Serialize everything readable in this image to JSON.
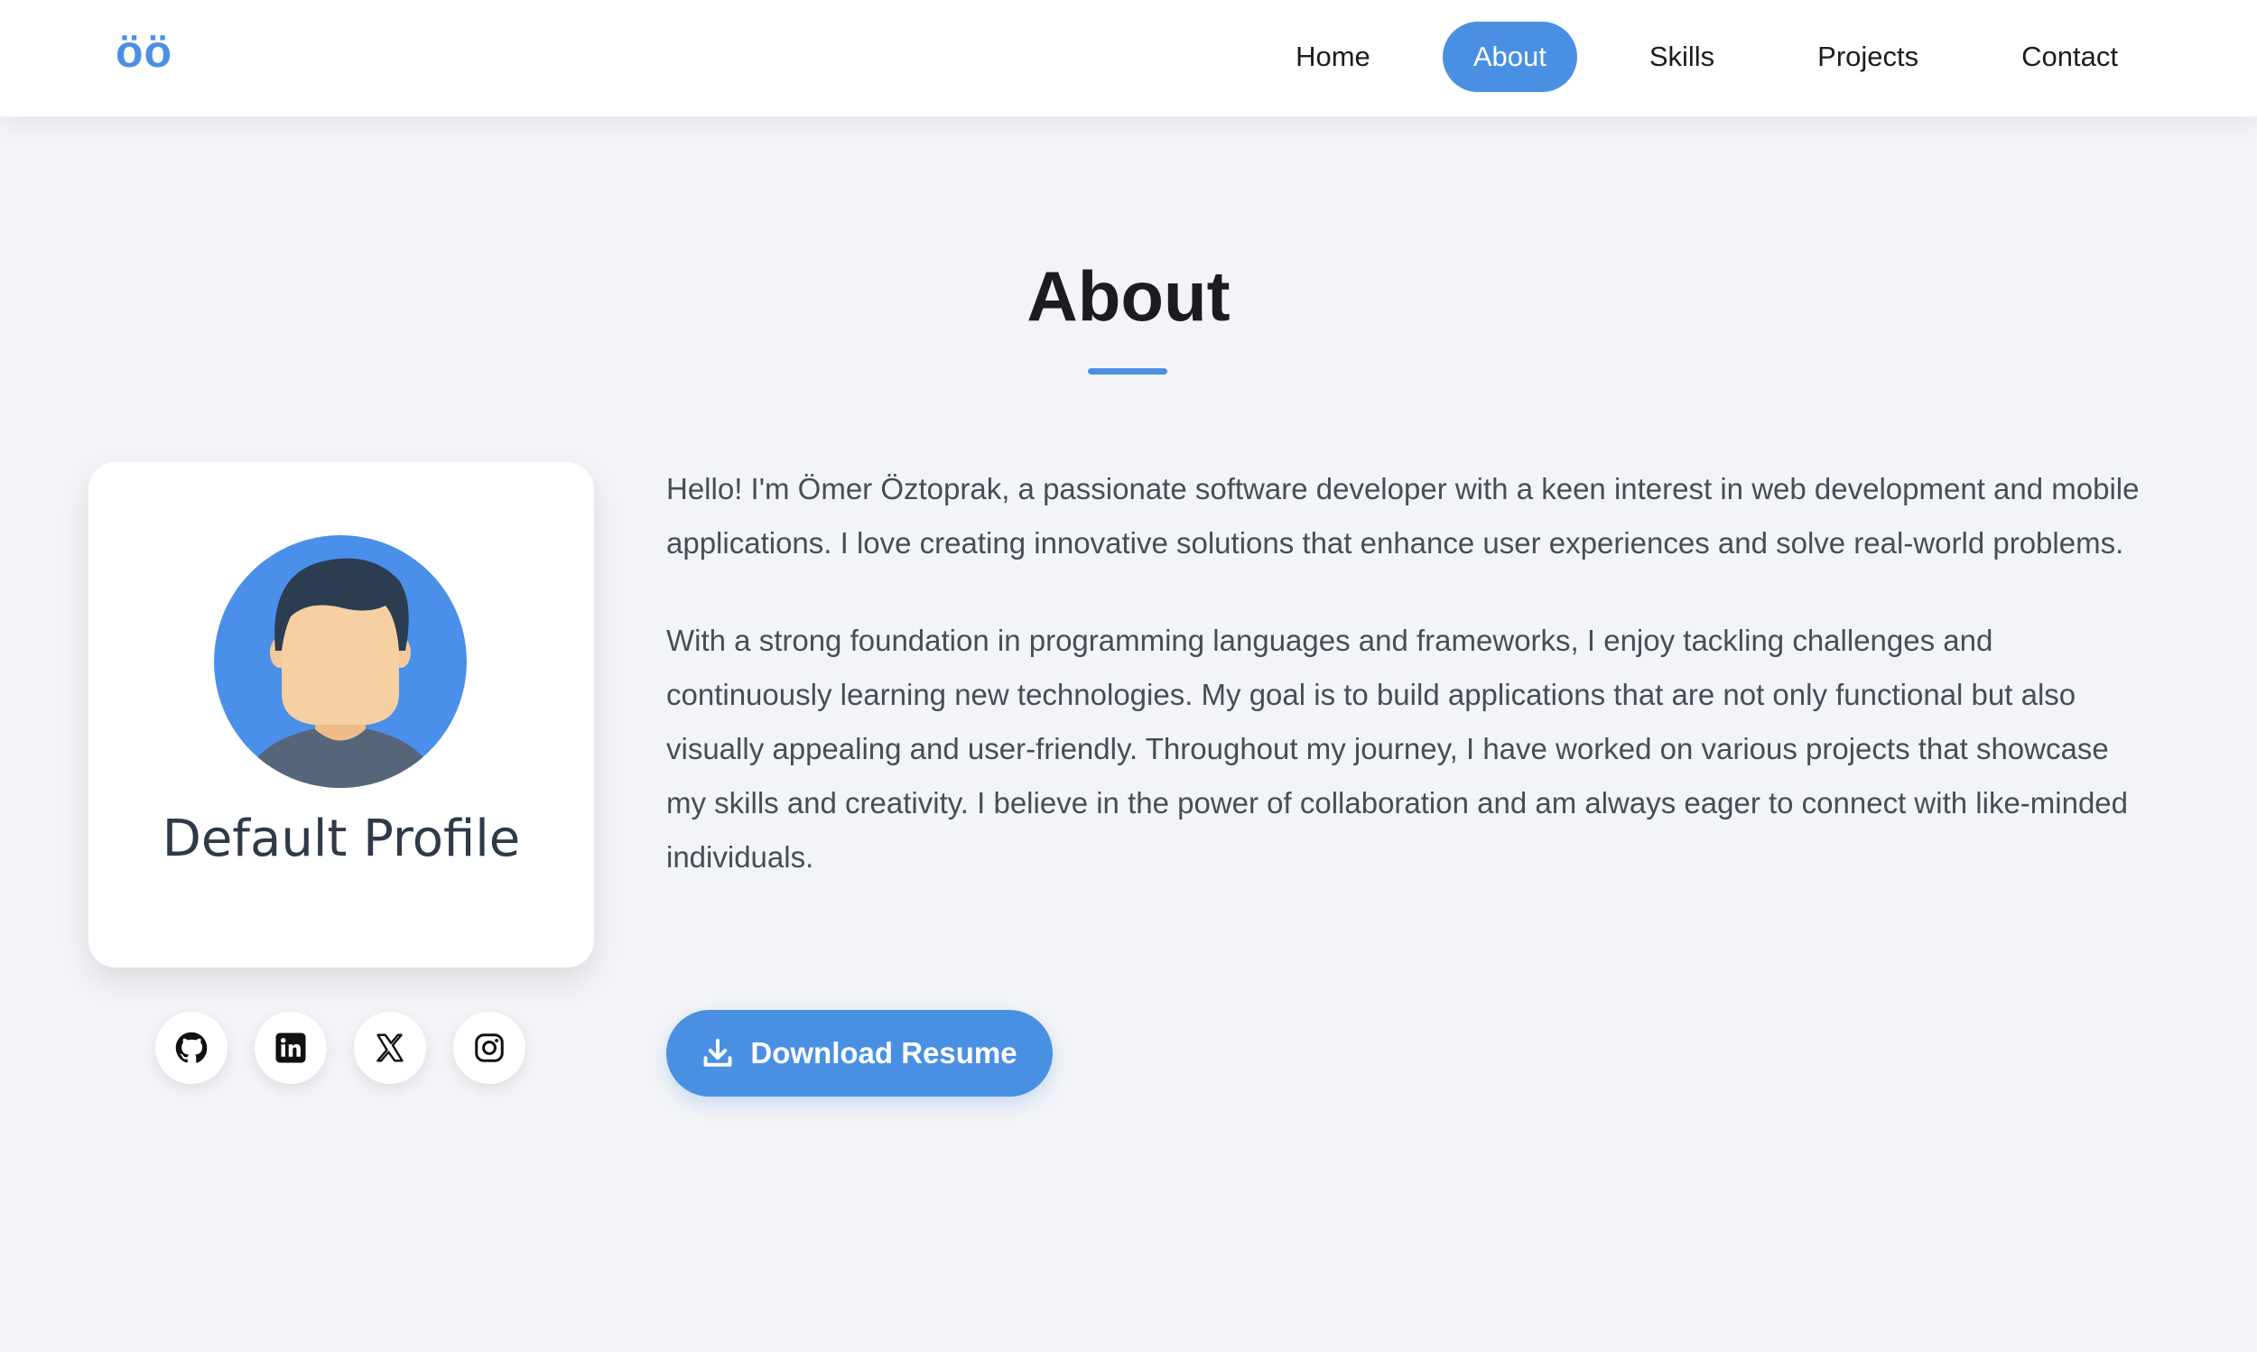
{
  "navbar": {
    "logo": "öö",
    "items": [
      {
        "label": "Home",
        "active": false
      },
      {
        "label": "About",
        "active": true
      },
      {
        "label": "Skills",
        "active": false
      },
      {
        "label": "Projects",
        "active": false
      },
      {
        "label": "Contact",
        "active": false
      }
    ]
  },
  "about": {
    "title": "About",
    "profile_name": "Default Profile",
    "paragraphs": [
      "Hello! I'm Ömer Öztoprak, a passionate software developer with a keen interest in web development and mobile applications. I love creating innovative solutions that enhance user experiences and solve real-world problems.",
      "With a strong foundation in programming languages and frameworks, I enjoy tackling challenges and continuously learning new technologies. My goal is to build applications that are not only functional but also visually appealing and user-friendly. Throughout my journey, I have worked on various projects that showcase my skills and creativity. I believe in the power of collaboration and am always eager to connect with like-minded individuals."
    ],
    "resume_button": "Download Resume",
    "socials": [
      "github-icon",
      "linkedin-icon",
      "x-icon",
      "instagram-icon"
    ]
  },
  "colors": {
    "accent": "#4a90e2",
    "background": "#f3f4f7",
    "text": "#474d57"
  }
}
